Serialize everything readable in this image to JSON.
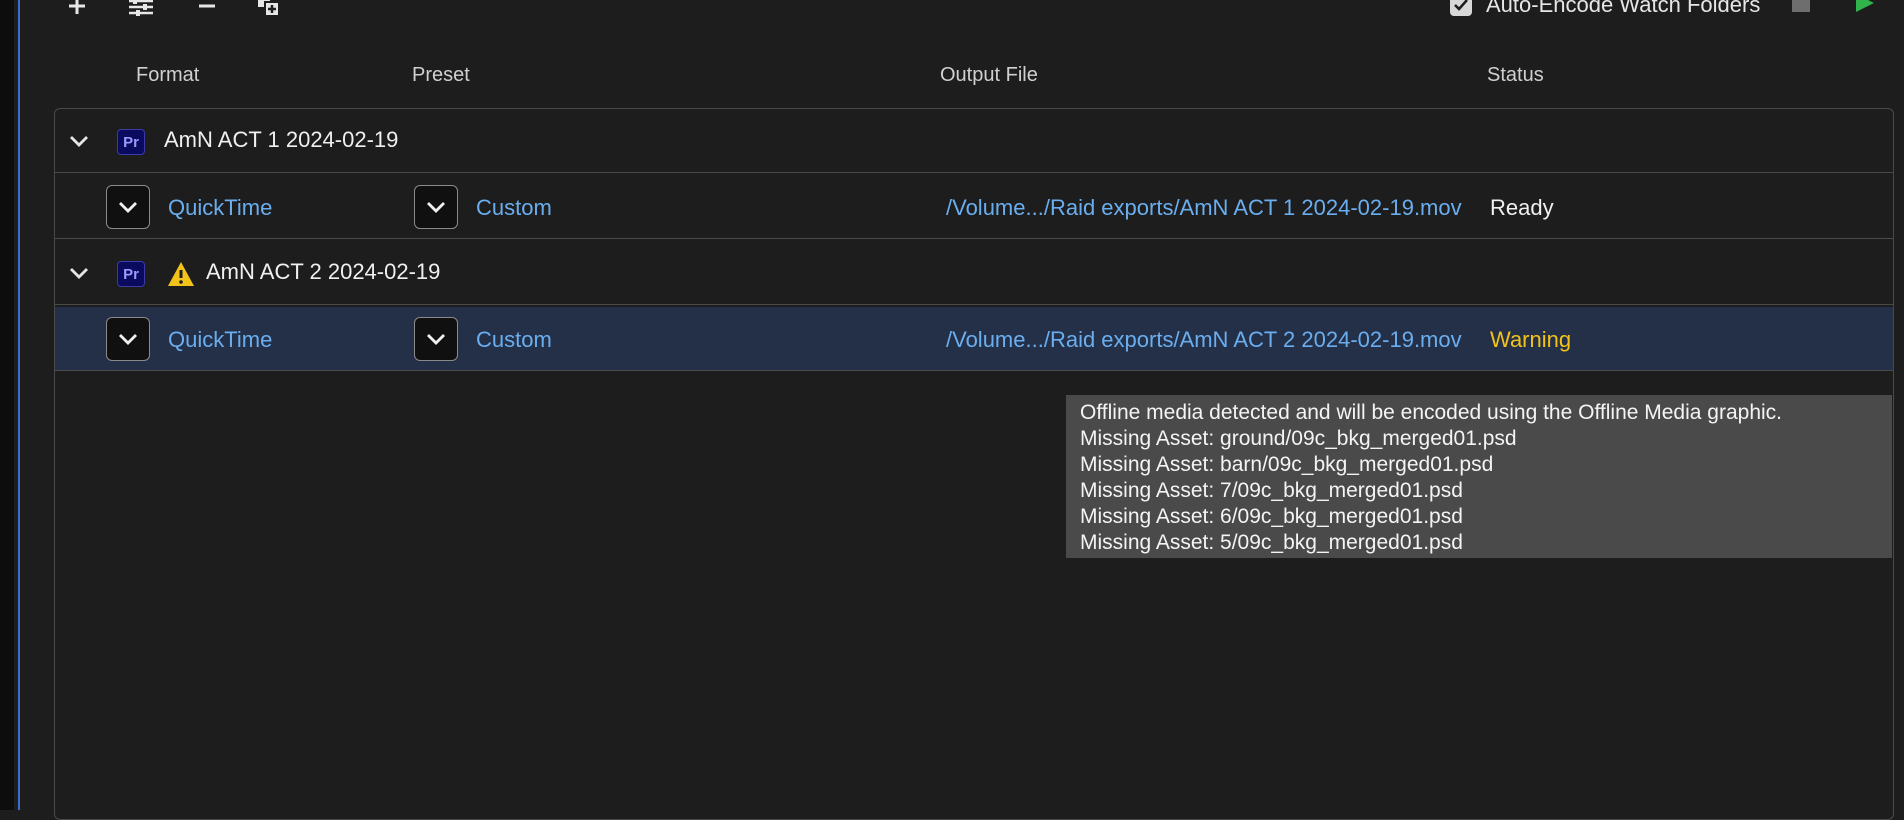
{
  "toolbar": {
    "add_icon": "plus-icon",
    "settings_icon": "settings-sliders-icon",
    "remove_icon": "minus-icon",
    "duplicate_icon": "duplicate-icon",
    "auto_encode_label": "Auto-Encode Watch Folders",
    "auto_encode_checked": true,
    "stop_icon": "stop-icon",
    "play_icon": "play-icon"
  },
  "columns": {
    "format": "Format",
    "preset": "Preset",
    "output": "Output File",
    "status": "Status"
  },
  "queue": [
    {
      "group": "AmN ACT 1 2024-02-19",
      "badge": "Pr",
      "warning": false,
      "item": {
        "format": "QuickTime",
        "preset": "Custom",
        "output": "/Volume.../Raid exports/AmN ACT 1 2024-02-19.mov",
        "status": "Ready"
      }
    },
    {
      "group": "AmN ACT 2 2024-02-19",
      "badge": "Pr",
      "warning": true,
      "item": {
        "format": "QuickTime",
        "preset": "Custom",
        "output": "/Volume.../Raid exports/AmN ACT 2 2024-02-19.mov",
        "status": "Warning"
      }
    }
  ],
  "tooltip": {
    "lines": [
      "Offline media detected and will be encoded using the Offline Media graphic.",
      "Missing Asset: ground/09c_bkg_merged01.psd",
      "Missing Asset: barn/09c_bkg_merged01.psd",
      "Missing Asset: 7/09c_bkg_merged01.psd",
      "Missing Asset: 6/09c_bkg_merged01.psd",
      "Missing Asset: 5/09c_bkg_merged01.psd"
    ]
  },
  "colors": {
    "background": "#1d1d1d",
    "link": "#6aaef0",
    "warning": "#f2c21b",
    "selected_row": "#243047",
    "play": "#2fb34a"
  }
}
